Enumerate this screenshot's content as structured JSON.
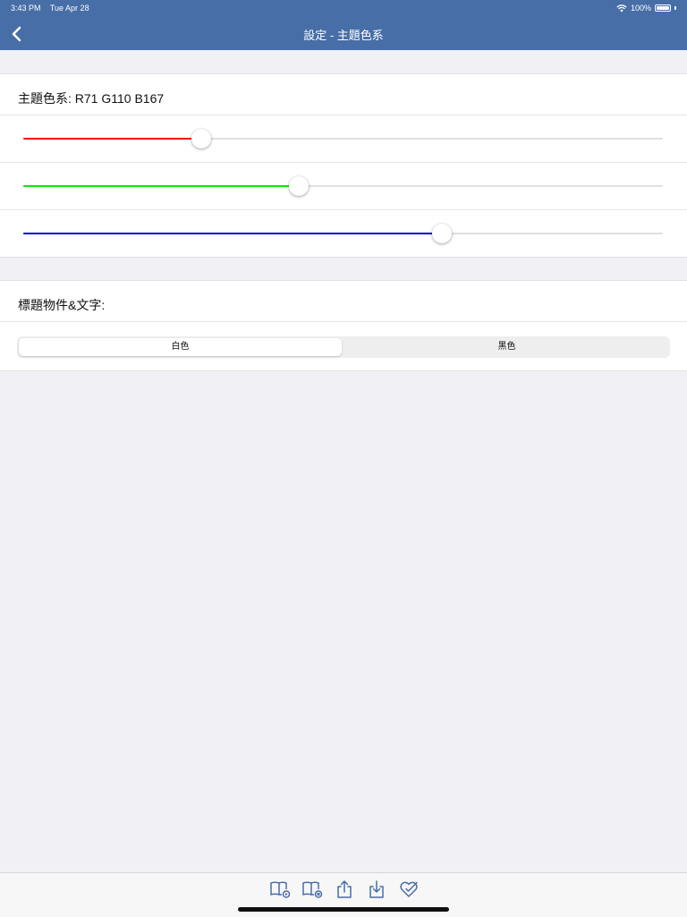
{
  "status": {
    "time": "3:43 PM",
    "date": "Tue Apr 28",
    "battery": "100%"
  },
  "nav": {
    "title": "設定 - 主題色系",
    "back_icon": "chevron-left-icon"
  },
  "theme": {
    "label": "主題色系: R71 G110 B167",
    "sliders": [
      {
        "name": "red",
        "value": 71,
        "max": 255,
        "color": "#ff0000"
      },
      {
        "name": "green",
        "value": 110,
        "max": 255,
        "color": "#00ee00"
      },
      {
        "name": "blue",
        "value": 167,
        "max": 255,
        "color": "#0000cc"
      }
    ]
  },
  "title_style": {
    "label": "標題物件&文字:",
    "options": [
      "白色",
      "黑色"
    ],
    "selected": "白色"
  },
  "toolbar": {
    "icons": [
      "book-play-icon",
      "book-remove-icon",
      "upload-icon",
      "download-icon",
      "heart-check-icon"
    ],
    "tint": "#476ea7"
  },
  "colors": {
    "nav_bg": "#476ea7",
    "page_bg": "#f1f1f5"
  }
}
